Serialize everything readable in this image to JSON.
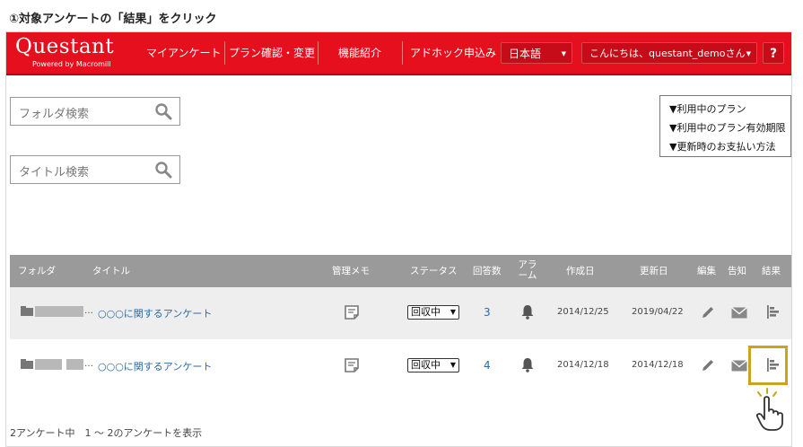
{
  "instruction": "①対象アンケートの「結果」をクリック",
  "header": {
    "logo": "Questant",
    "logo_sub": "Powered by Macromill",
    "nav": [
      "マイアンケート",
      "プラン確認・変更",
      "機能紹介",
      "アドホック申込み"
    ],
    "language": "日本語",
    "greeting": "こんにちは、questant_demoさん",
    "help": "?"
  },
  "sidebar": {
    "folder_search_placeholder": "フォルダ検索",
    "title_search_placeholder": "タイトル検索"
  },
  "plan_links": [
    "▼利用中のプラン",
    "▼利用中のプラン有効期限",
    "▼更新時のお支払い方法"
  ],
  "table": {
    "columns": [
      "フォルダ",
      "タイトル",
      "管理メモ",
      "ステータス",
      "回答数",
      "アラーム",
      "作成日",
      "更新日",
      "編集",
      "告知",
      "結果"
    ],
    "rows": [
      {
        "title": "○○○に関するアンケート",
        "status": "回収中",
        "responses": "3",
        "created": "2014/12/25",
        "updated": "2019/04/22"
      },
      {
        "title": "○○○に関するアンケート",
        "status": "回収中",
        "responses": "4",
        "created": "2014/12/18",
        "updated": "2014/12/18"
      }
    ]
  },
  "footer": "2アンケート中　1 ～ 2のアンケートを表示",
  "colors": {
    "brand_red": "#e60f1e",
    "link_blue": "#2a6aa8",
    "highlight": "#c8a51c"
  }
}
